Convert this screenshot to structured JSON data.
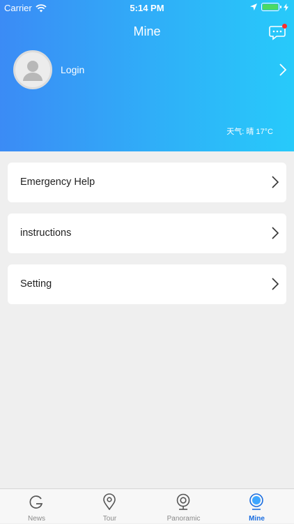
{
  "status_bar": {
    "carrier": "Carrier",
    "time": "5:14 PM",
    "battery_level": 1.0,
    "battery_color": "#4cd964"
  },
  "header": {
    "title": "Mine",
    "message_icon": "chat-bubble-icon",
    "has_notification": true,
    "notification_color": "#ff2d2d",
    "gradient_colors": [
      "#3b8bf5",
      "#27cafa"
    ]
  },
  "profile": {
    "login_label": "Login",
    "avatar_icon": "user-silhouette-icon"
  },
  "weather": {
    "text": "天气: 晴 17°C"
  },
  "menu": [
    {
      "label": "Emergency Help",
      "icon": "chevron-right-icon"
    },
    {
      "label": "instructions",
      "icon": "chevron-right-icon"
    },
    {
      "label": "Setting",
      "icon": "chevron-right-icon"
    }
  ],
  "tabs": [
    {
      "label": "News",
      "icon": "g-logo-icon",
      "active": false
    },
    {
      "label": "Tour",
      "icon": "map-pin-icon",
      "active": false
    },
    {
      "label": "Panoramic",
      "icon": "webcam-icon",
      "active": false
    },
    {
      "label": "Mine",
      "icon": "profile-circle-icon",
      "active": true
    }
  ],
  "colors": {
    "active_tab": "#1a6de0",
    "inactive_tab": "#8a8a8a",
    "page_background": "#efefef"
  }
}
